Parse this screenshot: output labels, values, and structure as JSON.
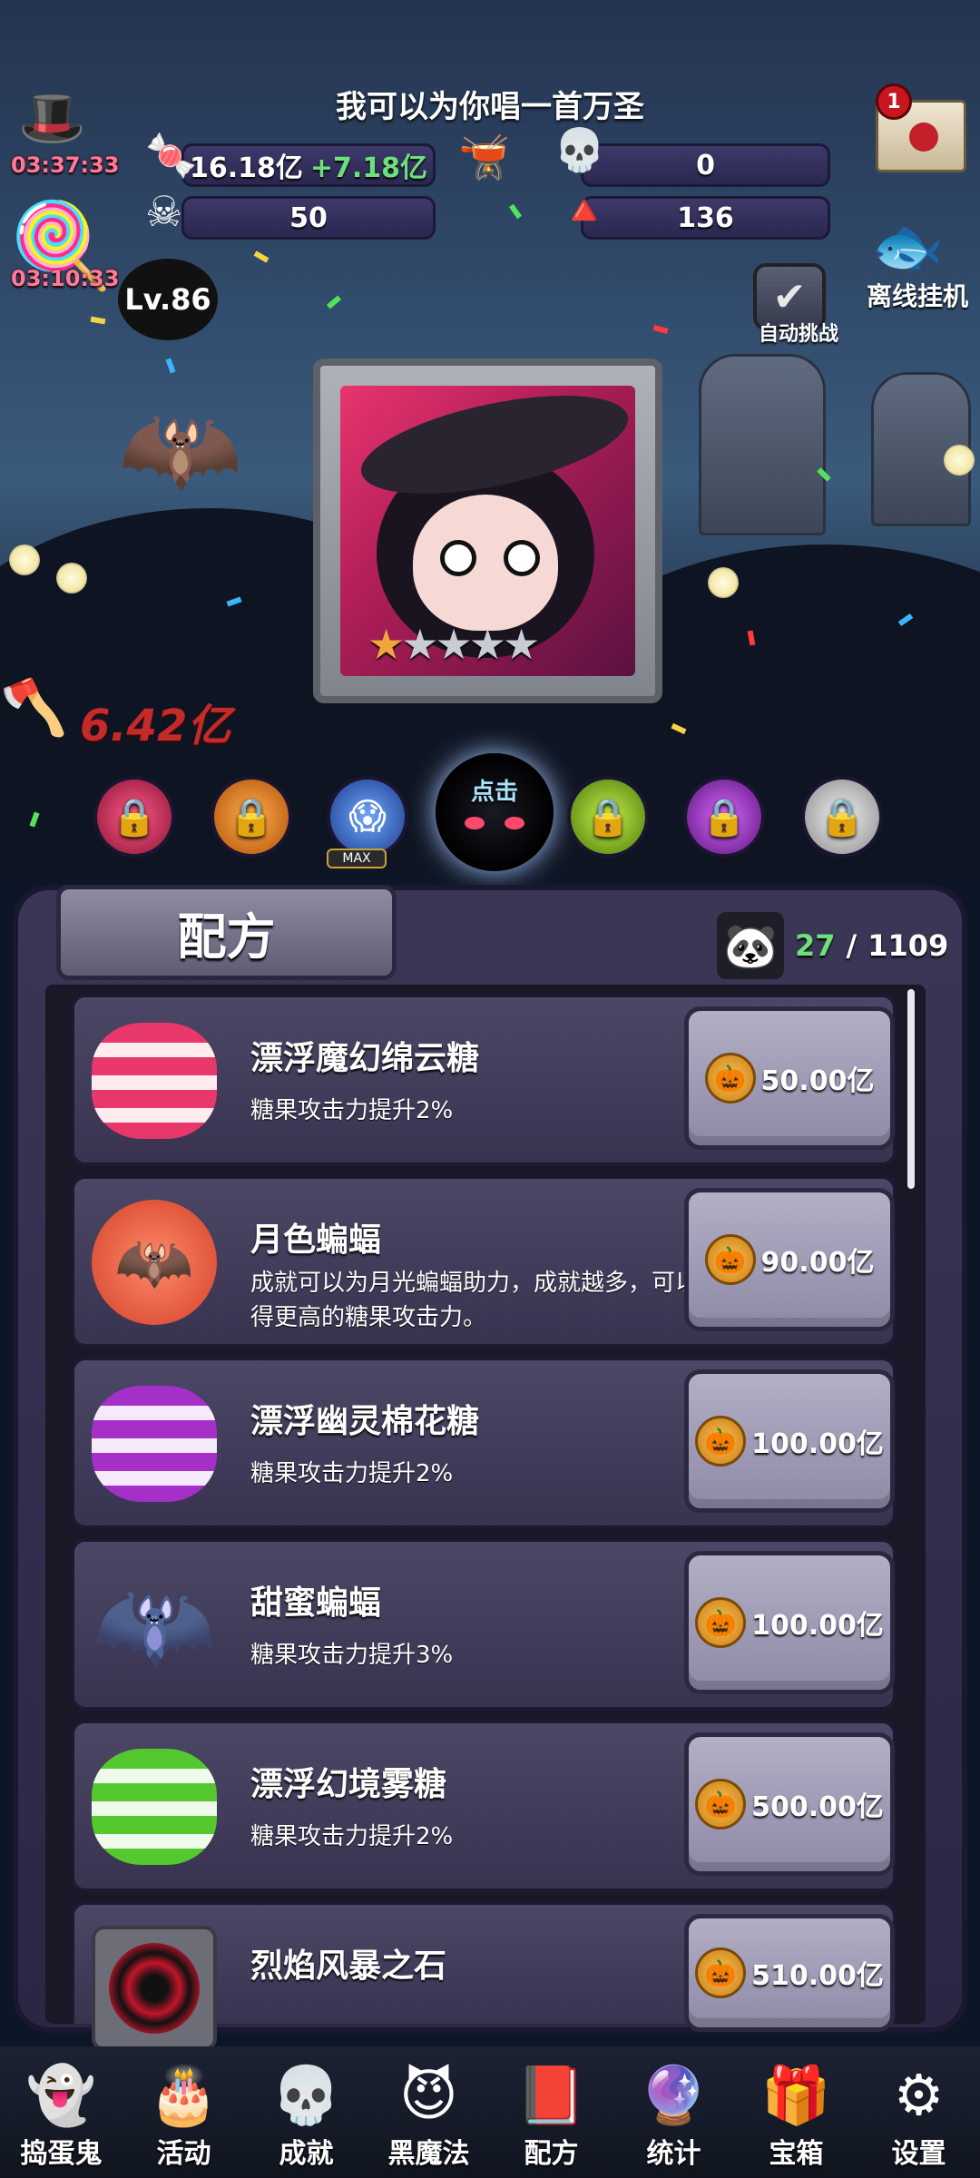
{
  "header": {
    "title": "我可以为你唱一首万圣",
    "timers": [
      "03:37:33",
      "03:10:33"
    ],
    "level": "Lv.86",
    "mail_badge": "1"
  },
  "stats": {
    "candy": "16.18亿",
    "candy_rate": "+7.18亿",
    "poison": "0",
    "skull": "50",
    "candy_corn": "136"
  },
  "actions": {
    "auto_challenge": "自动挑战",
    "offline": "离线挂机"
  },
  "boss": {
    "damage": "6.42亿",
    "stars_filled": 1,
    "stars_total": 5
  },
  "orbs": {
    "max_label": "MAX",
    "click_label": "点击"
  },
  "panel": {
    "title": "配方",
    "collected": "27",
    "separator": "/",
    "total": "1109"
  },
  "recipes": [
    {
      "name": "漂浮魔幻绵云糖",
      "desc": "糖果攻击力提升2%",
      "price": "50.00亿"
    },
    {
      "name": "月色蝙蝠",
      "desc": "成就可以为月光蝙蝠助力，成就越多，可以获得更高的糖果攻击力。",
      "price": "90.00亿"
    },
    {
      "name": "漂浮幽灵棉花糖",
      "desc": "糖果攻击力提升2%",
      "price": "100.00亿"
    },
    {
      "name": "甜蜜蝙蝠",
      "desc": "糖果攻击力提升3%",
      "price": "100.00亿"
    },
    {
      "name": "漂浮幻境雾糖",
      "desc": "糖果攻击力提升2%",
      "price": "500.00亿"
    },
    {
      "name": "烈焰风暴之石",
      "desc": "",
      "price": "510.00亿"
    }
  ],
  "nav": [
    {
      "label": "捣蛋鬼",
      "icon": "ghost-icon"
    },
    {
      "label": "活动",
      "icon": "eyeball-cake-icon"
    },
    {
      "label": "成就",
      "icon": "skull-trophy-icon"
    },
    {
      "label": "黑魔法",
      "icon": "demon-icon"
    },
    {
      "label": "配方",
      "icon": "spellbook-icon"
    },
    {
      "label": "统计",
      "icon": "crystal-ball-icon"
    },
    {
      "label": "宝箱",
      "icon": "treasure-chest-icon"
    },
    {
      "label": "设置",
      "icon": "gear-icon"
    }
  ],
  "colors": {
    "accent_green": "#6ee07b",
    "damage_red": "#c52a2a",
    "timer_pink": "#ff7a9a",
    "panel": "#3b3656"
  }
}
